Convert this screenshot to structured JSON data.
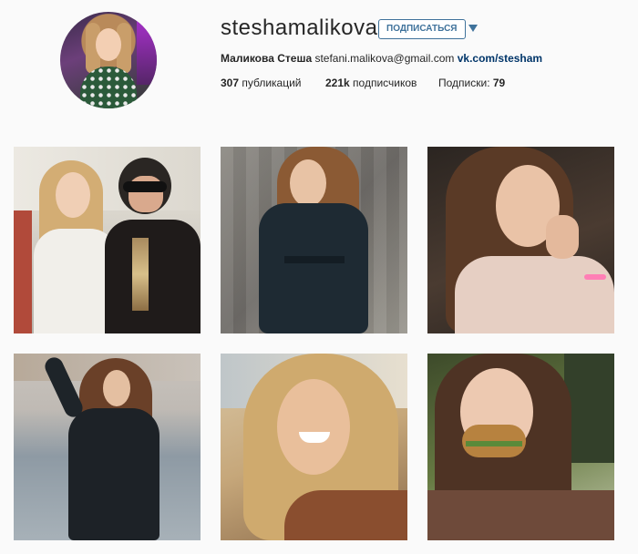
{
  "profile": {
    "username": "steshamalikova",
    "follow_label": "ПОДПИСАТЬСЯ",
    "full_name": "Маликова Стеша",
    "email": "stefani.malikova@gmail.com",
    "link": "vk.com/stesham"
  },
  "stats": {
    "posts_count": "307",
    "posts_label": "публикаций",
    "followers_count": "221k",
    "followers_label": "подписчиков",
    "following_label": "Подписки:",
    "following_count": "79"
  },
  "colors": {
    "accent": "#3f729b",
    "link": "#003569",
    "background": "#fafafa"
  },
  "icons": {
    "dropdown": "chevron-down-icon"
  }
}
